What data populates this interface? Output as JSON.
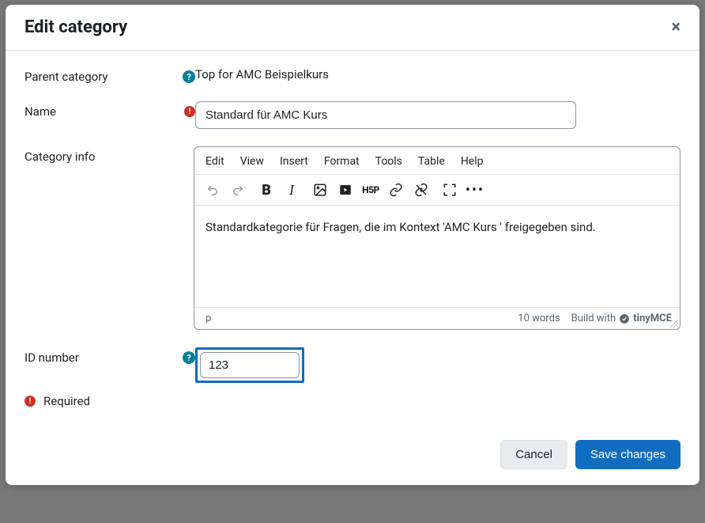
{
  "modal": {
    "title": "Edit category",
    "close_symbol": "×"
  },
  "labels": {
    "parent_category": "Parent category",
    "name": "Name",
    "category_info": "Category info",
    "id_number": "ID number",
    "required_note": "Required"
  },
  "values": {
    "parent_category_value": "Top for AMC Beispielkurs",
    "name_value": "Standard für AMC Kurs",
    "category_info_content": "Standardkategorie für Fragen, die im Kontext 'AMC Kurs ' freigegeben sind.",
    "id_number_value": "123"
  },
  "editor": {
    "menubar": [
      "Edit",
      "View",
      "Insert",
      "Format",
      "Tools",
      "Table",
      "Help"
    ],
    "footer_path": "p",
    "word_count": "10 words",
    "branding": "Build with",
    "branding_name": "tinyMCE"
  },
  "buttons": {
    "cancel": "Cancel",
    "save": "Save changes"
  },
  "symbols": {
    "help": "?",
    "required": "!"
  }
}
